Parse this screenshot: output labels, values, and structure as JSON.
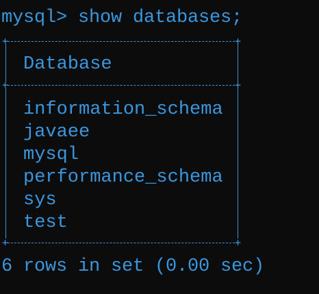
{
  "window": {
    "background": "#0c0c0c",
    "text_color": "#3a96dd"
  },
  "terminal": {
    "prompt": "mysql> show databases;",
    "header": "Database",
    "rows": [
      "information_schema",
      "javaee",
      "mysql",
      "performance_schema",
      "sys",
      "test"
    ],
    "result_summary": "6 rows in set (0.00 sec)"
  }
}
